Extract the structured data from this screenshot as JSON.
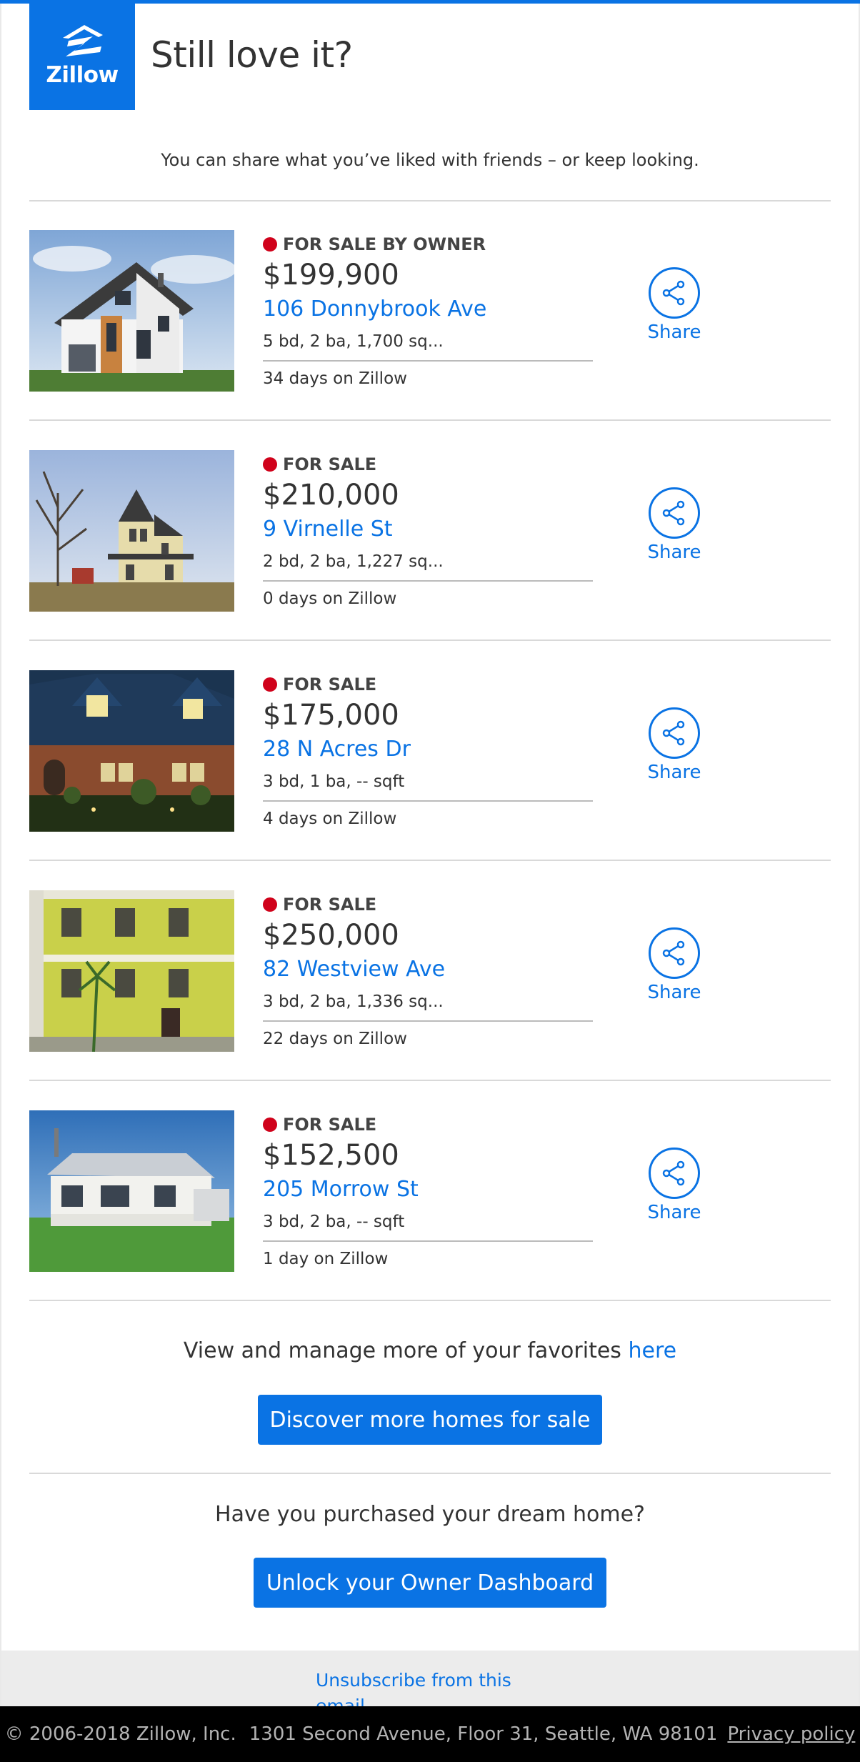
{
  "brand": {
    "name": "Zillow",
    "accent": "#0a73e4",
    "status_red": "#d0021b"
  },
  "header": {
    "title": "Still love it?",
    "subtitle": "You can share what you’ve liked with friends – or keep looking."
  },
  "listings": [
    {
      "status": "FOR SALE BY OWNER",
      "price": "$199,900",
      "address": "106 Donnybrook Ave",
      "facts": "5 bd, 2 ba, 1,700 sq...",
      "days": "34 days on Zillow",
      "share": "Share",
      "image": "modern-white-house-photo"
    },
    {
      "status": "FOR SALE",
      "price": "$210,000",
      "address": "9 Virnelle St",
      "facts": "2 bd, 2 ba, 1,227 sq...",
      "days": "0 days on Zillow",
      "share": "Share",
      "image": "victorian-house-photo"
    },
    {
      "status": "FOR SALE",
      "price": "$175,000",
      "address": "28 N Acres Dr",
      "facts": "3 bd, 1 ba, -- sqft",
      "days": "4 days on Zillow",
      "share": "Share",
      "image": "brick-house-night-photo"
    },
    {
      "status": "FOR SALE",
      "price": "$250,000",
      "address": "82 Westview Ave",
      "facts": "3 bd, 2 ba, 1,336 sq...",
      "days": "22 days on Zillow",
      "share": "Share",
      "image": "yellow-townhouse-photo"
    },
    {
      "status": "FOR SALE",
      "price": "$152,500",
      "address": "205 Morrow St",
      "facts": "3 bd, 2 ba, -- sqft",
      "days": "1 day on Zillow",
      "share": "Share",
      "image": "white-bungalow-photo"
    }
  ],
  "favorites": {
    "text": "View and manage more of your favorites ",
    "link": "here"
  },
  "discover_button": "Discover more homes for sale",
  "owner": {
    "question": "Have you purchased your dream home?",
    "button": "Unlock your Owner Dashboard"
  },
  "unsubscribe": "Unsubscribe from this email",
  "footer": {
    "copyright": "© 2006-2018 Zillow, Inc.",
    "address": "1301 Second Avenue, Floor 31, Seattle, WA 98101",
    "privacy": "Privacy policy"
  }
}
